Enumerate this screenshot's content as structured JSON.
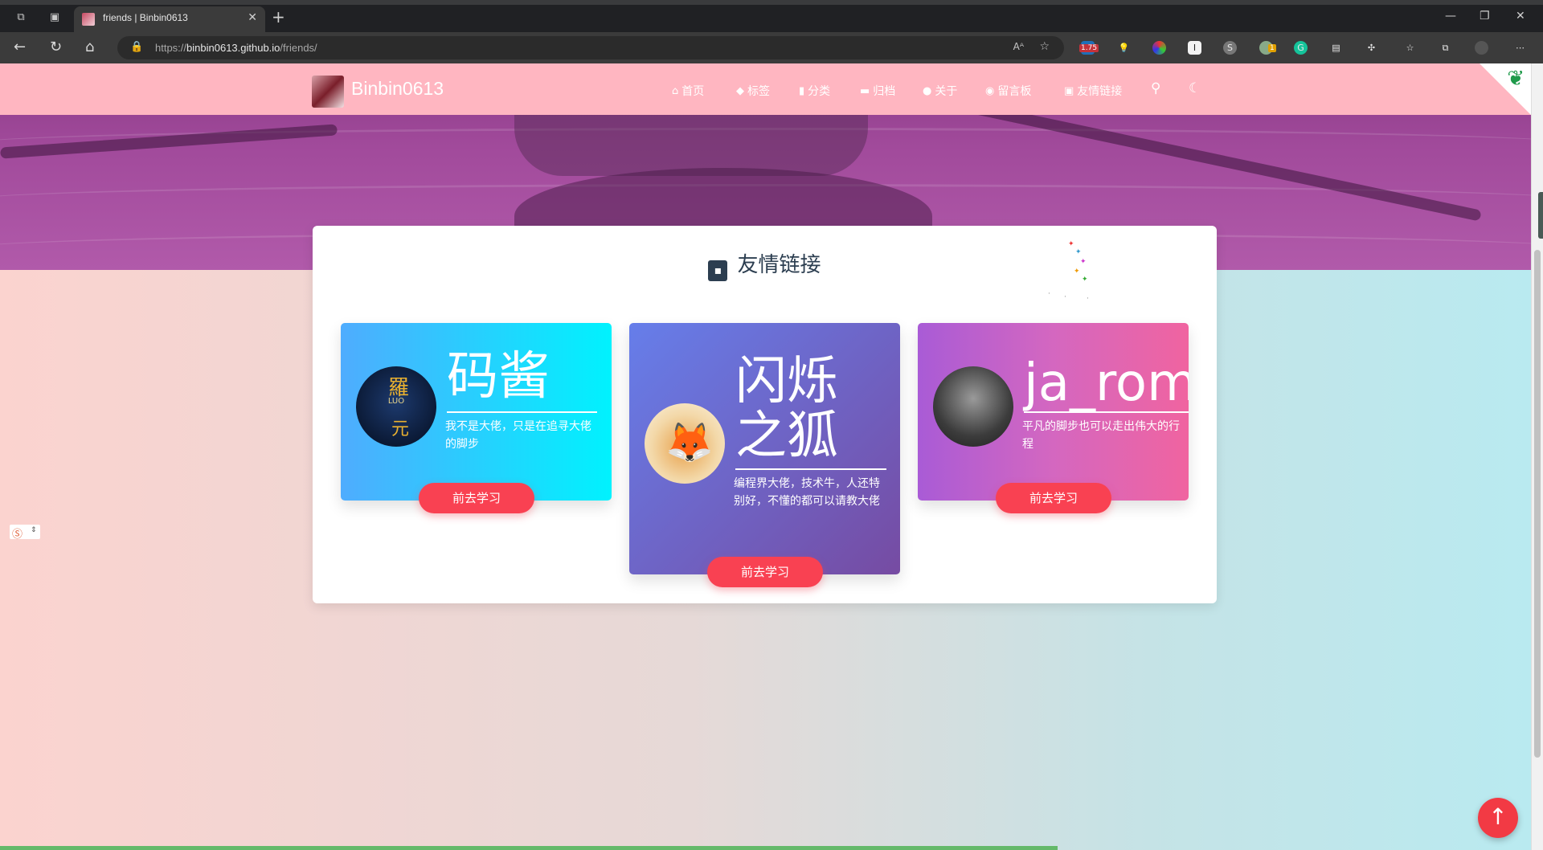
{
  "browser": {
    "tab_title": "friends | Binbin0613",
    "url_prefix": "https://",
    "url_domain": "binbin0613.github.io",
    "url_path": "/friends/",
    "read_aloud_label": "Aᴬ",
    "extension_badge": "1.75",
    "extension_badge_2": "1"
  },
  "site": {
    "brand": "Binbin0613",
    "nav": [
      {
        "icon": "home-icon",
        "label": "首页"
      },
      {
        "icon": "tag-icon",
        "label": "标签"
      },
      {
        "icon": "bookmark-icon",
        "label": "分类"
      },
      {
        "icon": "archive-icon",
        "label": "归档"
      },
      {
        "icon": "user-circle-icon",
        "label": "关于"
      },
      {
        "icon": "comments-icon",
        "label": "留言板"
      },
      {
        "icon": "address-book-icon",
        "label": "友情链接"
      }
    ]
  },
  "card": {
    "title": "友情链接"
  },
  "friends": [
    {
      "name": "码酱",
      "desc": "我不是大佬，只是在追寻大佬的脚步",
      "button": "前去学习",
      "avatar_text": "LUO"
    },
    {
      "name_line1": "闪烁",
      "name_line2": "之狐",
      "desc": "编程界大佬，技术牛，人还特别好，不懂的都可以请教大佬",
      "button": "前去学习"
    },
    {
      "name": "ja_rome",
      "desc": "平凡的脚步也可以走出伟大的行程",
      "button": "前去学习"
    }
  ],
  "colors": {
    "nav_bg": "#ffb6c1",
    "button": "#f94152",
    "to_top": "#f23a44",
    "progress": "#64b96a"
  }
}
